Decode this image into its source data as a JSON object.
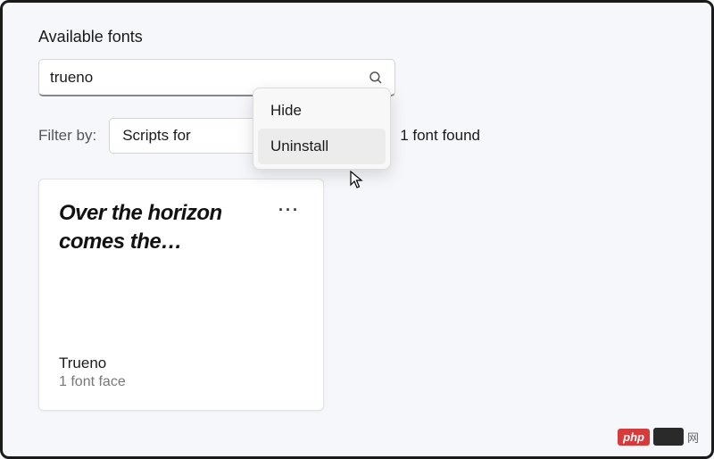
{
  "section_title": "Available fonts",
  "search": {
    "value": "trueno"
  },
  "filter": {
    "label": "Filter by:",
    "selected": "Scripts for"
  },
  "count_text": "1 font found",
  "context_menu": {
    "items": [
      "Hide",
      "Uninstall"
    ]
  },
  "font_card": {
    "preview": "Over the horizon comes the…",
    "name": "Trueno",
    "faces": "1 font face",
    "more": "···"
  },
  "watermark": {
    "badge": "php",
    "text": "网"
  }
}
